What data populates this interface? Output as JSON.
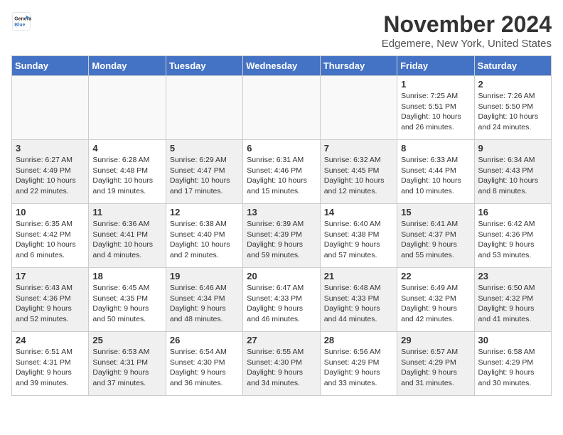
{
  "header": {
    "logo_general": "General",
    "logo_blue": "Blue",
    "month": "November 2024",
    "location": "Edgemere, New York, United States"
  },
  "weekdays": [
    "Sunday",
    "Monday",
    "Tuesday",
    "Wednesday",
    "Thursday",
    "Friday",
    "Saturday"
  ],
  "weeks": [
    [
      {
        "day": "",
        "text": "",
        "empty": true
      },
      {
        "day": "",
        "text": "",
        "empty": true
      },
      {
        "day": "",
        "text": "",
        "empty": true
      },
      {
        "day": "",
        "text": "",
        "empty": true
      },
      {
        "day": "",
        "text": "",
        "empty": true
      },
      {
        "day": "1",
        "text": "Sunrise: 7:25 AM\nSunset: 5:51 PM\nDaylight: 10 hours and 26 minutes."
      },
      {
        "day": "2",
        "text": "Sunrise: 7:26 AM\nSunset: 5:50 PM\nDaylight: 10 hours and 24 minutes."
      }
    ],
    [
      {
        "day": "3",
        "text": "Sunrise: 6:27 AM\nSunset: 4:49 PM\nDaylight: 10 hours and 22 minutes.",
        "shaded": true
      },
      {
        "day": "4",
        "text": "Sunrise: 6:28 AM\nSunset: 4:48 PM\nDaylight: 10 hours and 19 minutes."
      },
      {
        "day": "5",
        "text": "Sunrise: 6:29 AM\nSunset: 4:47 PM\nDaylight: 10 hours and 17 minutes.",
        "shaded": true
      },
      {
        "day": "6",
        "text": "Sunrise: 6:31 AM\nSunset: 4:46 PM\nDaylight: 10 hours and 15 minutes."
      },
      {
        "day": "7",
        "text": "Sunrise: 6:32 AM\nSunset: 4:45 PM\nDaylight: 10 hours and 12 minutes.",
        "shaded": true
      },
      {
        "day": "8",
        "text": "Sunrise: 6:33 AM\nSunset: 4:44 PM\nDaylight: 10 hours and 10 minutes."
      },
      {
        "day": "9",
        "text": "Sunrise: 6:34 AM\nSunset: 4:43 PM\nDaylight: 10 hours and 8 minutes.",
        "shaded": true
      }
    ],
    [
      {
        "day": "10",
        "text": "Sunrise: 6:35 AM\nSunset: 4:42 PM\nDaylight: 10 hours and 6 minutes."
      },
      {
        "day": "11",
        "text": "Sunrise: 6:36 AM\nSunset: 4:41 PM\nDaylight: 10 hours and 4 minutes.",
        "shaded": true
      },
      {
        "day": "12",
        "text": "Sunrise: 6:38 AM\nSunset: 4:40 PM\nDaylight: 10 hours and 2 minutes."
      },
      {
        "day": "13",
        "text": "Sunrise: 6:39 AM\nSunset: 4:39 PM\nDaylight: 9 hours and 59 minutes.",
        "shaded": true
      },
      {
        "day": "14",
        "text": "Sunrise: 6:40 AM\nSunset: 4:38 PM\nDaylight: 9 hours and 57 minutes."
      },
      {
        "day": "15",
        "text": "Sunrise: 6:41 AM\nSunset: 4:37 PM\nDaylight: 9 hours and 55 minutes.",
        "shaded": true
      },
      {
        "day": "16",
        "text": "Sunrise: 6:42 AM\nSunset: 4:36 PM\nDaylight: 9 hours and 53 minutes."
      }
    ],
    [
      {
        "day": "17",
        "text": "Sunrise: 6:43 AM\nSunset: 4:36 PM\nDaylight: 9 hours and 52 minutes.",
        "shaded": true
      },
      {
        "day": "18",
        "text": "Sunrise: 6:45 AM\nSunset: 4:35 PM\nDaylight: 9 hours and 50 minutes."
      },
      {
        "day": "19",
        "text": "Sunrise: 6:46 AM\nSunset: 4:34 PM\nDaylight: 9 hours and 48 minutes.",
        "shaded": true
      },
      {
        "day": "20",
        "text": "Sunrise: 6:47 AM\nSunset: 4:33 PM\nDaylight: 9 hours and 46 minutes."
      },
      {
        "day": "21",
        "text": "Sunrise: 6:48 AM\nSunset: 4:33 PM\nDaylight: 9 hours and 44 minutes.",
        "shaded": true
      },
      {
        "day": "22",
        "text": "Sunrise: 6:49 AM\nSunset: 4:32 PM\nDaylight: 9 hours and 42 minutes."
      },
      {
        "day": "23",
        "text": "Sunrise: 6:50 AM\nSunset: 4:32 PM\nDaylight: 9 hours and 41 minutes.",
        "shaded": true
      }
    ],
    [
      {
        "day": "24",
        "text": "Sunrise: 6:51 AM\nSunset: 4:31 PM\nDaylight: 9 hours and 39 minutes."
      },
      {
        "day": "25",
        "text": "Sunrise: 6:53 AM\nSunset: 4:31 PM\nDaylight: 9 hours and 37 minutes.",
        "shaded": true
      },
      {
        "day": "26",
        "text": "Sunrise: 6:54 AM\nSunset: 4:30 PM\nDaylight: 9 hours and 36 minutes."
      },
      {
        "day": "27",
        "text": "Sunrise: 6:55 AM\nSunset: 4:30 PM\nDaylight: 9 hours and 34 minutes.",
        "shaded": true
      },
      {
        "day": "28",
        "text": "Sunrise: 6:56 AM\nSunset: 4:29 PM\nDaylight: 9 hours and 33 minutes."
      },
      {
        "day": "29",
        "text": "Sunrise: 6:57 AM\nSunset: 4:29 PM\nDaylight: 9 hours and 31 minutes.",
        "shaded": true
      },
      {
        "day": "30",
        "text": "Sunrise: 6:58 AM\nSunset: 4:29 PM\nDaylight: 9 hours and 30 minutes."
      }
    ]
  ]
}
